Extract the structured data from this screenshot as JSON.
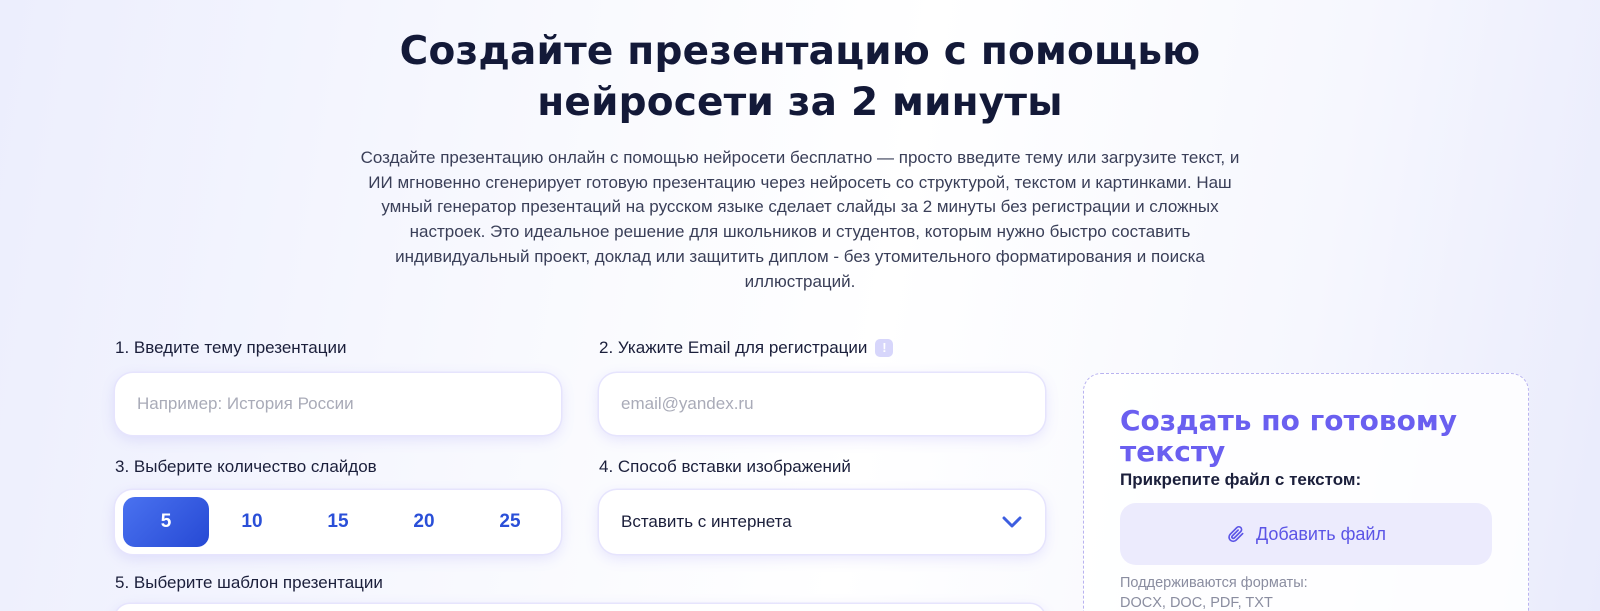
{
  "hero": {
    "title_line1": "Создайте презентацию с помощью",
    "title_line2": "нейросети за 2 минуты",
    "description": "Создайте презентацию онлайн с помощью нейросети бесплатно — просто введите тему или загрузите текст, и ИИ мгновенно сгенерирует готовую презентацию через нейросеть со структурой, текстом и картинками. Наш умный генератор презентаций на русском языке сделает слайды за 2 минуты без регистрации и сложных настроек. Это идеальное решение для школьников и студентов, которым нужно быстро составить индивидуальный проект, доклад или защитить диплом - без утомительного форматирования и поиска иллюстраций."
  },
  "form": {
    "topic_label": "1. Введите тему презентации",
    "topic_placeholder": "Например: История России",
    "email_label": "2. Укажите Email для регистрации",
    "email_info_badge": "!",
    "email_placeholder": "email@yandex.ru",
    "slides_label": "3. Выберите количество слайдов",
    "slide_options": [
      "5",
      "10",
      "15",
      "20",
      "25"
    ],
    "slides_selected": "5",
    "images_label": "4. Способ вставки изображений",
    "images_selected": "Вставить с интернета",
    "template_label": "5. Выберите шаблон презентации"
  },
  "upload": {
    "title": "Создать по готовому тексту",
    "subtitle": "Прикрепите файл с текстом:",
    "button_label": "Добавить файл",
    "formats_line1": "Поддерживаются форматы:",
    "formats_line2": "DOCX, DOC, PDF, TXT"
  },
  "colors": {
    "accent": "#6a5ff0",
    "primary_blue": "#2a4fd8",
    "title_dark": "#131938"
  },
  "icons": {
    "info": "info-badge-icon",
    "dropdown": "chevron-down-icon",
    "attach": "paperclip-icon"
  }
}
